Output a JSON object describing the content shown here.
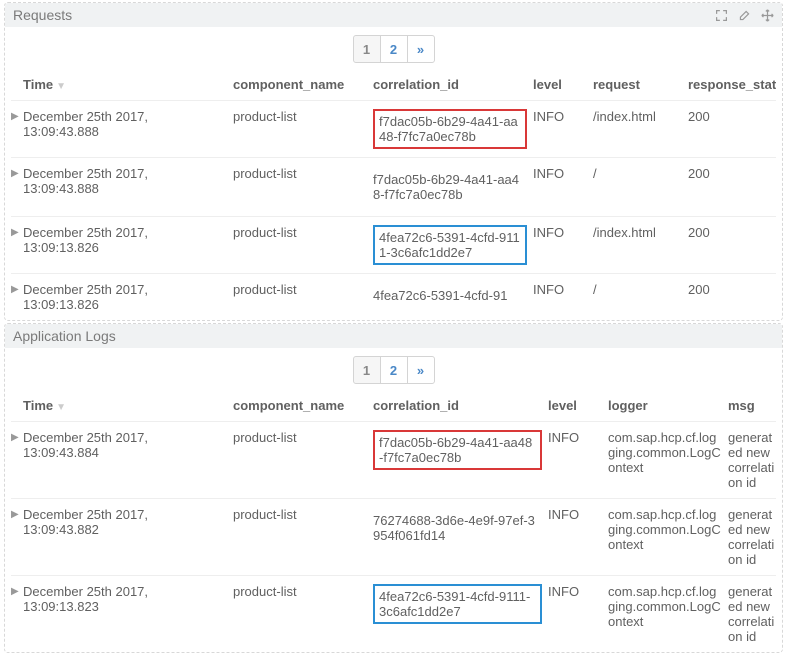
{
  "requests": {
    "title": "Requests",
    "pager": {
      "p1": "1",
      "p2": "2",
      "next": "»"
    },
    "columns": {
      "time": "Time",
      "component": "component_name",
      "correlation": "correlation_id",
      "level": "level",
      "a": "request",
      "b": "response_status"
    },
    "rows": [
      {
        "time": "December 25th 2017, 13:09:43.888",
        "component": "product-list",
        "correlation": "f7dac05b-6b29-4a41-aa48-f7fc7a0ec78b",
        "highlight": "red",
        "level": "INFO",
        "a": "/index.html",
        "b": "200"
      },
      {
        "time": "December 25th 2017, 13:09:43.888",
        "component": "product-list",
        "correlation": "f7dac05b-6b29-4a41-aa48-f7fc7a0ec78b",
        "highlight": "",
        "level": "INFO",
        "a": "/",
        "b": "200"
      },
      {
        "time": "December 25th 2017, 13:09:13.826",
        "component": "product-list",
        "correlation": "4fea72c6-5391-4cfd-9111-3c6afc1dd2e7",
        "highlight": "blue",
        "level": "INFO",
        "a": "/index.html",
        "b": "200"
      },
      {
        "time": "December 25th 2017, 13:09:13.826",
        "component": "product-list",
        "correlation": "4fea72c6-5391-4cfd-91",
        "highlight": "",
        "level": "INFO",
        "a": "/",
        "b": "200"
      }
    ]
  },
  "applogs": {
    "title": "Application Logs",
    "pager": {
      "p1": "1",
      "p2": "2",
      "next": "»"
    },
    "columns": {
      "time": "Time",
      "component": "component_name",
      "correlation": "correlation_id",
      "level": "level",
      "a": "logger",
      "b": "msg"
    },
    "rows": [
      {
        "time": "December 25th 2017, 13:09:43.884",
        "component": "product-list",
        "correlation": "f7dac05b-6b29-4a41-aa48-f7fc7a0ec78b",
        "highlight": "red",
        "level": "INFO",
        "a": "com.sap.hcp.cf.logging.common.LogContext",
        "b": "generated new correlation id"
      },
      {
        "time": "December 25th 2017, 13:09:43.882",
        "component": "product-list",
        "correlation": "76274688-3d6e-4e9f-97ef-3954f061fd14",
        "highlight": "",
        "level": "INFO",
        "a": "com.sap.hcp.cf.logging.common.LogContext",
        "b": "generated new correlation id"
      },
      {
        "time": "December 25th 2017, 13:09:13.823",
        "component": "product-list",
        "correlation": "4fea72c6-5391-4cfd-9111-3c6afc1dd2e7",
        "highlight": "blue",
        "level": "INFO",
        "a": "com.sap.hcp.cf.logging.common.LogContext",
        "b": "generated new correlation id"
      }
    ]
  }
}
